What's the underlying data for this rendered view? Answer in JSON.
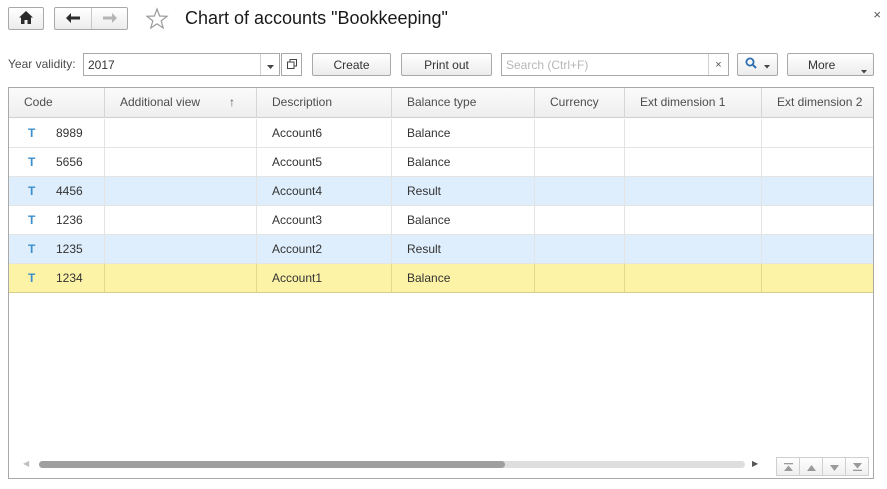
{
  "window": {
    "title": "Chart of accounts \"Bookkeeping\"",
    "close_glyph": "×"
  },
  "icons": {
    "home": "home-icon",
    "back": "arrow-left-icon",
    "forward": "arrow-right-icon",
    "favorite": "star-icon",
    "search": "magnifier-icon",
    "account_type": "T-account-icon"
  },
  "toolbar": {
    "year_label": "Year validity:",
    "year_value": "2017",
    "create_label": "Create",
    "print_label": "Print out",
    "search_placeholder": "Search (Ctrl+F)",
    "search_clear": "×",
    "more_label": "More"
  },
  "table": {
    "columns": [
      {
        "label": "Code"
      },
      {
        "label": "Additional view",
        "sort": "↑"
      },
      {
        "label": "Description"
      },
      {
        "label": "Balance type"
      },
      {
        "label": "Currency"
      },
      {
        "label": "Ext dimension 1"
      },
      {
        "label": "Ext dimension 2"
      }
    ],
    "rows": [
      {
        "icon": "T",
        "code": "8989",
        "additional_view": "",
        "description": "Account6",
        "balance_type": "Balance",
        "currency": "",
        "ext1": "",
        "ext2": ""
      },
      {
        "icon": "T",
        "code": "5656",
        "additional_view": "",
        "description": "Account5",
        "balance_type": "Balance",
        "currency": "",
        "ext1": "",
        "ext2": ""
      },
      {
        "icon": "T",
        "code": "4456",
        "additional_view": "",
        "description": "Account4",
        "balance_type": "Result",
        "currency": "",
        "ext1": "",
        "ext2": ""
      },
      {
        "icon": "T",
        "code": "1236",
        "additional_view": "",
        "description": "Account3",
        "balance_type": "Balance",
        "currency": "",
        "ext1": "",
        "ext2": ""
      },
      {
        "icon": "T",
        "code": "1235",
        "additional_view": "",
        "description": "Account2",
        "balance_type": "Result",
        "currency": "",
        "ext1": "",
        "ext2": ""
      },
      {
        "icon": "T",
        "code": "1234",
        "additional_view": "",
        "description": "Account1",
        "balance_type": "Balance",
        "currency": "",
        "ext1": "",
        "ext2": ""
      }
    ],
    "selected_row": 5
  },
  "colors": {
    "row_result_bg": "#deeefc",
    "row_selected_bg": "#fdf3a6",
    "account_icon": "#3b8fcd"
  },
  "scroll": {
    "horizontal_thumb_fraction": 0.66
  }
}
